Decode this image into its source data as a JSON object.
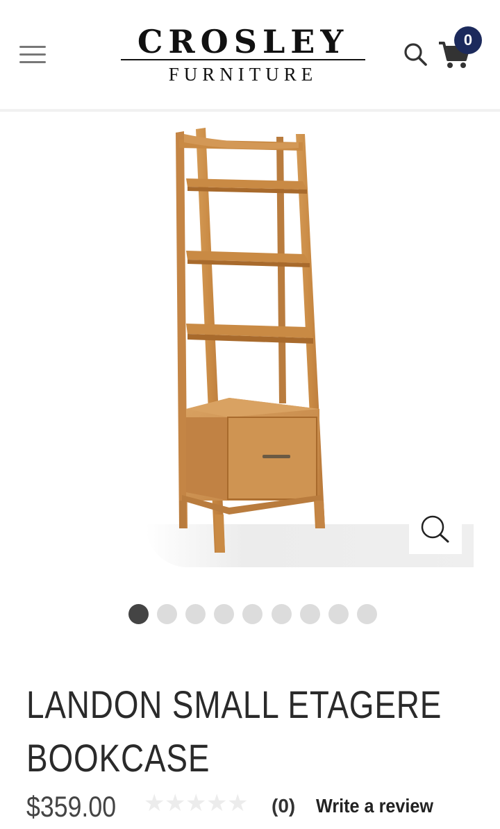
{
  "header": {
    "brand_top": "CROSLEY",
    "brand_bottom": "FURNITURE",
    "cart_count": "0",
    "colors": {
      "badge": "#1c2a5c",
      "icon": "#333333"
    }
  },
  "gallery": {
    "image_count": 9,
    "active_index": 0
  },
  "product": {
    "title_line1": "LANDON SMALL ETAGERE",
    "title_line2": "BOOKCASE",
    "price": "$359.00",
    "rating": 0,
    "review_count": "(0)",
    "write_review_label": "Write a review"
  },
  "colors": {
    "wood": "#c98a44",
    "wood_dark": "#a86a2c",
    "wood_light": "#d9a262"
  }
}
